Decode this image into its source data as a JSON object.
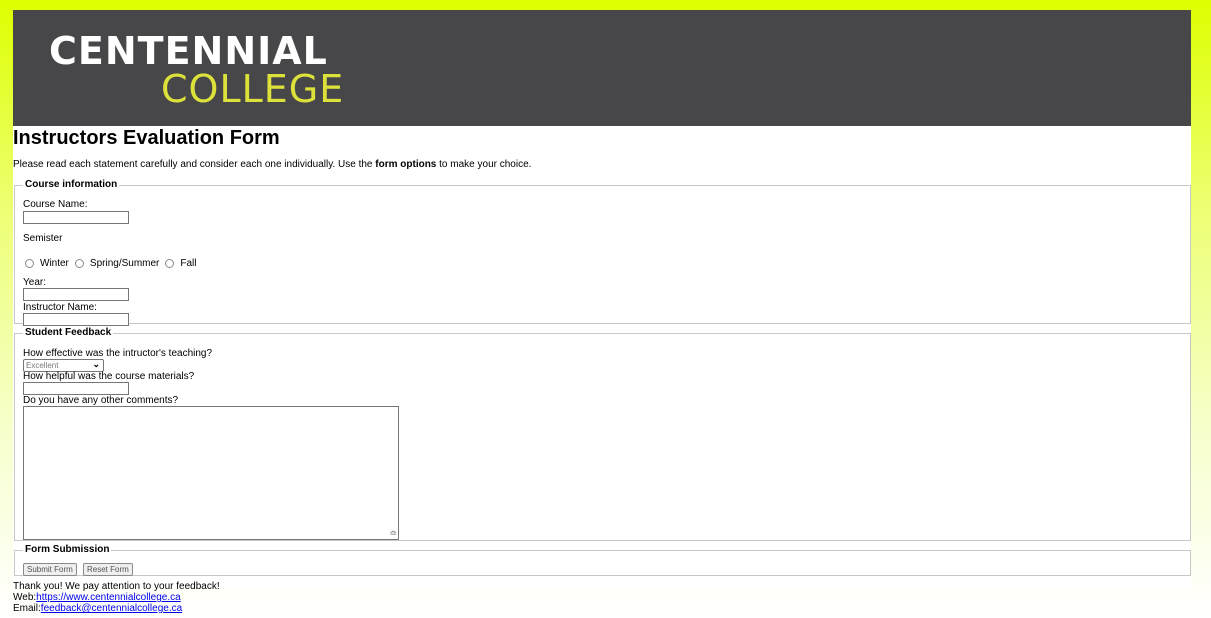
{
  "banner": {
    "logo_line1": "CENTENNIAL",
    "logo_line2": "COLLEGE",
    "bg_color": "#474749",
    "accent_color": "#dce23a"
  },
  "page": {
    "title": "Instructors Evaluation Form",
    "intro_prefix": "Please read each statement carefully and consider each one individually. Use the ",
    "intro_bold": "form options",
    "intro_suffix": " to make your choice."
  },
  "course_info": {
    "legend": "Course information",
    "course_name_label": "Course Name:",
    "course_name_value": "",
    "semester_label": "Semister",
    "semester_options": [
      "Winter",
      "Spring/Summer",
      "Fall"
    ],
    "year_label": "Year:",
    "year_value": "",
    "instructor_label": "Instructor Name:",
    "instructor_value": ""
  },
  "feedback": {
    "legend": "Student Feedback",
    "effective_label": "How effective was the intructor's teaching?",
    "effective_selected": "Excellent",
    "materials_label": "How helpful was the course materials?",
    "materials_value": "",
    "comments_label": "Do you have any other comments?",
    "comments_value": ""
  },
  "submission": {
    "legend": "Form Submission",
    "submit_label": "Submit Form",
    "reset_label": "Reset Form"
  },
  "footer": {
    "thanks": "Thank you! We pay attention to your feedback!",
    "web_label": "Web:",
    "web_link": "https://www.centennialcollege.ca",
    "email_label": "Email:",
    "email_link": "feedback@centennialcollege.ca"
  }
}
